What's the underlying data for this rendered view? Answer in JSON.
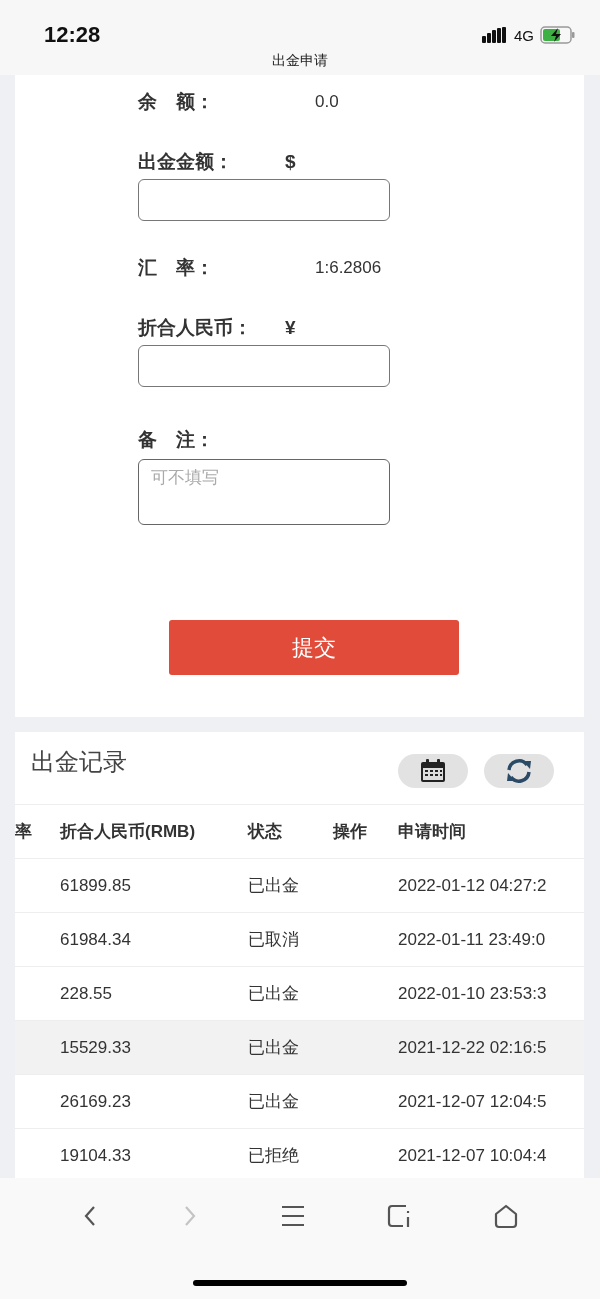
{
  "status_bar": {
    "time": "12:28",
    "network": "4G"
  },
  "page_title": "出金申请",
  "form": {
    "balance": {
      "label": "余　额：",
      "value": "0.0"
    },
    "amount": {
      "label": "出金金额：",
      "currency": "$"
    },
    "rate": {
      "label": "汇　率：",
      "value": "1:6.2806"
    },
    "rmb": {
      "label": "折合人民币：",
      "currency": "¥"
    },
    "note": {
      "label": "备　注：",
      "placeholder": "可不填写"
    },
    "submit": "提交"
  },
  "records": {
    "title": "出金记录",
    "columns": [
      "率",
      "折合人民币(RMB)",
      "状态",
      "操作",
      "申请时间"
    ],
    "rows": [
      {
        "rmb": "61899.85",
        "status": "已出金",
        "time": "2022-01-12 04:27:2",
        "selected": false
      },
      {
        "rmb": "61984.34",
        "status": "已取消",
        "time": "2022-01-11 23:49:0",
        "selected": false
      },
      {
        "rmb": "228.55",
        "status": "已出金",
        "time": "2022-01-10 23:53:3",
        "selected": false
      },
      {
        "rmb": "15529.33",
        "status": "已出金",
        "time": "2021-12-22 02:16:5",
        "selected": true
      },
      {
        "rmb": "26169.23",
        "status": "已出金",
        "time": "2021-12-07 12:04:5",
        "selected": false
      },
      {
        "rmb": "19104.33",
        "status": "已拒绝",
        "time": "2021-12-07 10:04:4",
        "selected": false
      }
    ]
  },
  "browser_nav": {
    "back_disabled": false,
    "forward_disabled": true
  }
}
